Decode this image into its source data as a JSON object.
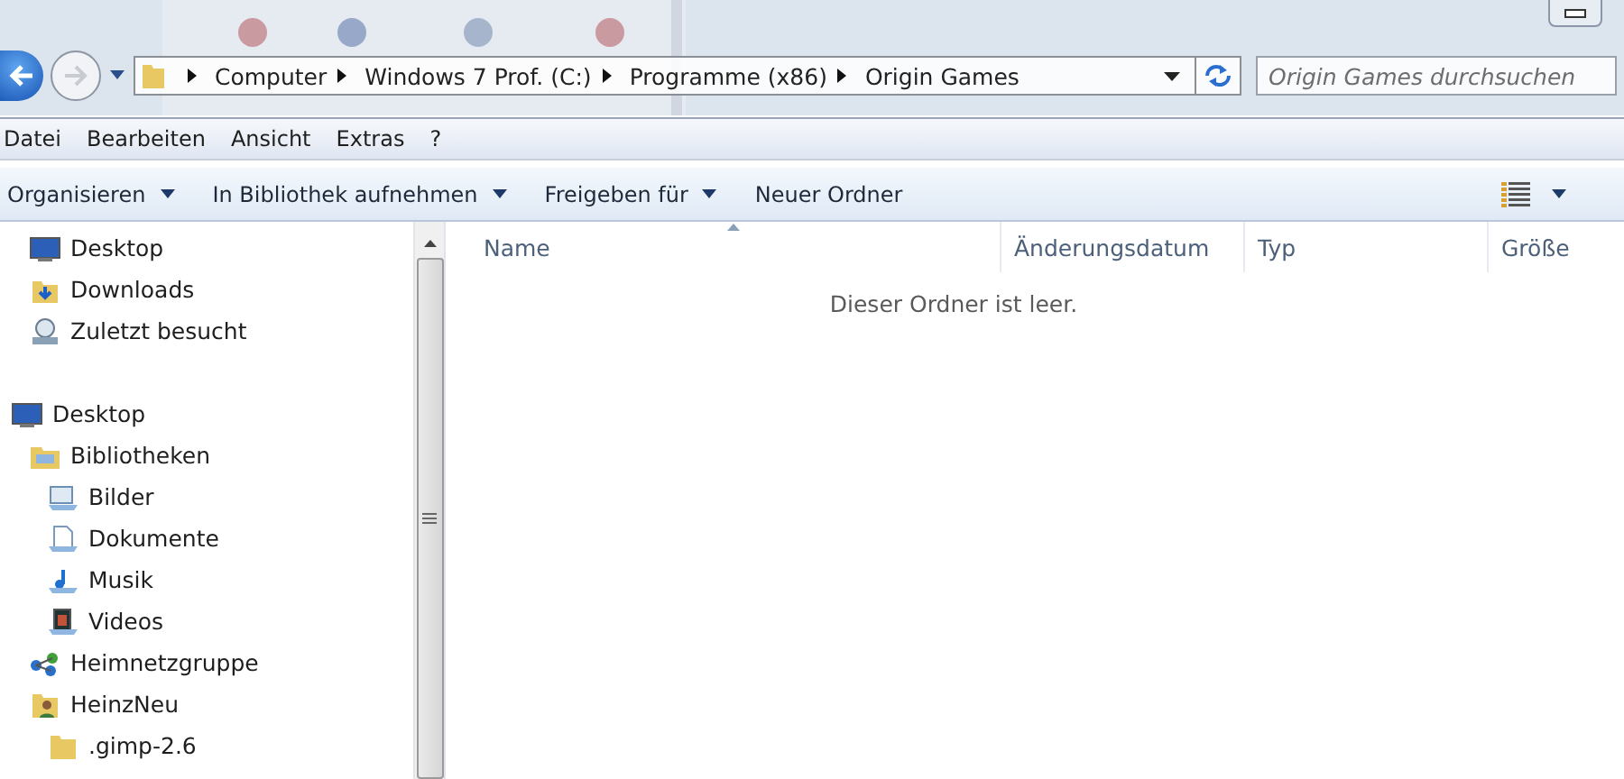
{
  "breadcrumb": [
    "Computer",
    "Windows 7 Prof. (C:)",
    "Programme (x86)",
    "Origin Games"
  ],
  "search": {
    "placeholder": "Origin Games durchsuchen"
  },
  "menu": [
    "Datei",
    "Bearbeiten",
    "Ansicht",
    "Extras",
    "?"
  ],
  "toolbar": [
    {
      "label": "Organisieren",
      "dropdown": true
    },
    {
      "label": "In Bibliothek aufnehmen",
      "dropdown": true
    },
    {
      "label": "Freigeben für",
      "dropdown": true
    },
    {
      "label": "Neuer Ordner",
      "dropdown": false
    }
  ],
  "favorites": [
    {
      "label": "Desktop",
      "kind": "monitor"
    },
    {
      "label": "Downloads",
      "kind": "download"
    },
    {
      "label": "Zuletzt besucht",
      "kind": "recent"
    }
  ],
  "tree": [
    {
      "label": "Desktop",
      "kind": "monitor",
      "children": [
        {
          "label": "Bibliotheken",
          "kind": "library",
          "children": [
            {
              "label": "Bilder",
              "kind": "pictures"
            },
            {
              "label": "Dokumente",
              "kind": "documents"
            },
            {
              "label": "Musik",
              "kind": "music"
            },
            {
              "label": "Videos",
              "kind": "videos"
            }
          ]
        },
        {
          "label": "Heimnetzgruppe",
          "kind": "network"
        },
        {
          "label": "HeinzNeu",
          "kind": "user",
          "children": [
            {
              "label": ".gimp-2.6",
              "kind": "folder"
            }
          ]
        }
      ]
    }
  ],
  "columns": [
    "Name",
    "Änderungsdatum",
    "Typ",
    "Größe"
  ],
  "empty_message": "Dieser Ordner ist leer."
}
